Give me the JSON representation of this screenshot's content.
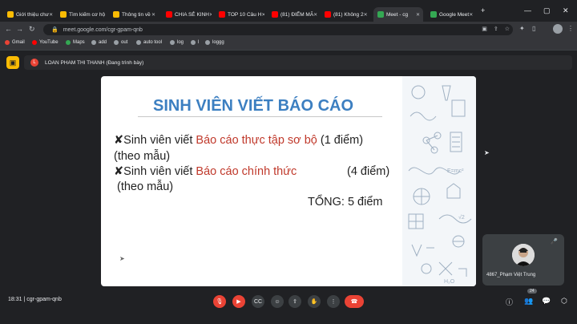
{
  "tabs": [
    {
      "label": "Giới thiệu chư",
      "color": "#fbbc04",
      "active": false
    },
    {
      "label": "Tìm kiếm cơ hộ",
      "color": "#fbbc04",
      "active": false
    },
    {
      "label": "Thông tin về",
      "color": "#fbbc04",
      "active": false
    },
    {
      "label": "CHIA SẺ KINH",
      "color": "#ff0000",
      "active": false
    },
    {
      "label": "TOP 10 Câu H",
      "color": "#ff0000",
      "active": false
    },
    {
      "label": "(81) ĐIỂM MÃ",
      "color": "#ff0000",
      "active": false
    },
    {
      "label": "(81) Không 2",
      "color": "#ff0000",
      "active": false
    },
    {
      "label": "Meet - cg",
      "color": "#34a853",
      "active": true
    },
    {
      "label": "Google Meet",
      "color": "#34a853",
      "active": false
    }
  ],
  "address": {
    "url": "meet.google.com/cgr-gpam-qnb"
  },
  "bookmarks": [
    {
      "label": "Gmail",
      "color": "#ea4335"
    },
    {
      "label": "YouTube",
      "color": "#ff0000"
    },
    {
      "label": "Maps",
      "color": "#34a853"
    },
    {
      "label": "add",
      "color": "#9aa0a6"
    },
    {
      "label": "out",
      "color": "#9aa0a6"
    },
    {
      "label": "auto tool",
      "color": "#9aa0a6"
    },
    {
      "label": "log",
      "color": "#9aa0a6"
    },
    {
      "label": "l",
      "color": "#9aa0a6"
    },
    {
      "label": "loggg",
      "color": "#9aa0a6"
    }
  ],
  "presenter": {
    "initial": "L",
    "text": "LOAN PHAM THI THANH (Đang trình bày)"
  },
  "slide": {
    "title": "SINH VIÊN VIẾT BÁO CÁO",
    "line1_prefix": "✘Sinh viên viết ",
    "line1_red": "Báo cáo thực tập sơ bộ",
    "line1_suffix": " (1 điểm)",
    "line2": "(theo mẫu)",
    "line3_prefix": "✘Sinh viên viết ",
    "line3_red": "Báo cáo chính thức",
    "line3_suffix": "(4 điểm)",
    "line4": "(theo mẫu)",
    "total": "TỔNG: 5 điểm"
  },
  "participant": {
    "name": "4867_Phạm Việt Trung"
  },
  "bottom": {
    "time": "18:31",
    "separator": "|",
    "meeting_code": "cgr-gpam-qnb",
    "people_count": "24"
  },
  "colors": {
    "accent_red": "#ea4335",
    "meet_yellow": "#fbbc04",
    "title_blue": "#3c7fc1",
    "slide_red": "#c0392b"
  }
}
